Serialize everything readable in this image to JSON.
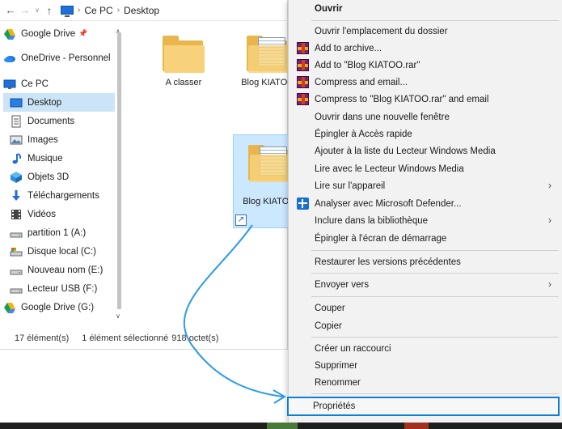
{
  "address": {
    "crumbs": [
      "Ce PC",
      "Desktop"
    ]
  },
  "sidebar": {
    "items": [
      {
        "label": "Google Drive",
        "icon": "google-drive-icon",
        "pin": "📌"
      },
      {
        "label": "OneDrive - Personnel",
        "icon": "onedrive-icon"
      },
      {
        "label": "Ce PC",
        "icon": "computer-icon"
      },
      {
        "label": "Desktop",
        "icon": "desktop-icon",
        "selected": true
      },
      {
        "label": "Documents",
        "icon": "documents-icon"
      },
      {
        "label": "Images",
        "icon": "images-icon"
      },
      {
        "label": "Musique",
        "icon": "music-icon"
      },
      {
        "label": "Objets 3D",
        "icon": "objects-3d-icon"
      },
      {
        "label": "Téléchargements",
        "icon": "downloads-icon"
      },
      {
        "label": "Vidéos",
        "icon": "videos-icon"
      },
      {
        "label": "partition 1 (A:)",
        "icon": "drive-icon"
      },
      {
        "label": "Disque local (C:)",
        "icon": "local-disk-icon"
      },
      {
        "label": "Nouveau nom (E:)",
        "icon": "drive-icon"
      },
      {
        "label": "Lecteur USB (F:)",
        "icon": "usb-drive-icon"
      },
      {
        "label": "Google Drive (G:)",
        "icon": "google-drive-icon"
      }
    ]
  },
  "content": {
    "files": [
      {
        "label": "A classer",
        "type": "folder"
      },
      {
        "label": "Blog KIATOO",
        "type": "folder-docs"
      },
      {
        "label": "Blog KIATOO",
        "type": "folder-docs-shortcut",
        "selected": true
      }
    ]
  },
  "status": {
    "count": "17 élément(s)",
    "selection": "1 élément sélectionné",
    "size": "918 octet(s)"
  },
  "menu": {
    "items": [
      {
        "label": "Ouvrir",
        "bold": true
      },
      {
        "label": "Ouvrir l'emplacement du dossier"
      },
      {
        "label": "Add to archive...",
        "icon": "winrar-icon"
      },
      {
        "label": "Add to \"Blog KIATOO.rar\"",
        "icon": "winrar-icon"
      },
      {
        "label": "Compress and email...",
        "icon": "winrar-icon"
      },
      {
        "label": "Compress to \"Blog KIATOO.rar\" and email",
        "icon": "winrar-icon"
      },
      {
        "label": "Ouvrir dans une nouvelle fenêtre"
      },
      {
        "label": "Épingler à Accès rapide"
      },
      {
        "label": "Ajouter à la liste du Lecteur Windows Media"
      },
      {
        "label": "Lire avec le Lecteur Windows Media"
      },
      {
        "label": "Lire sur l'appareil",
        "submenu": true
      },
      {
        "label": "Analyser avec Microsoft Defender...",
        "icon": "defender-icon"
      },
      {
        "label": "Inclure dans la bibliothèque",
        "submenu": true
      },
      {
        "label": "Épingler à l'écran de démarrage"
      },
      {
        "label": "Restaurer les versions précédentes"
      },
      {
        "label": "Envoyer vers",
        "submenu": true
      },
      {
        "label": "Couper"
      },
      {
        "label": "Copier"
      },
      {
        "label": "Créer un raccourci"
      },
      {
        "label": "Supprimer"
      },
      {
        "label": "Renommer"
      },
      {
        "label": "Propriétés",
        "highlighted": true
      }
    ],
    "submenu_arrow": "›"
  },
  "colors": {
    "selection": "#cce4f7",
    "highlight_border": "#0c7fd6",
    "menu_bg": "#f2f2f2"
  }
}
